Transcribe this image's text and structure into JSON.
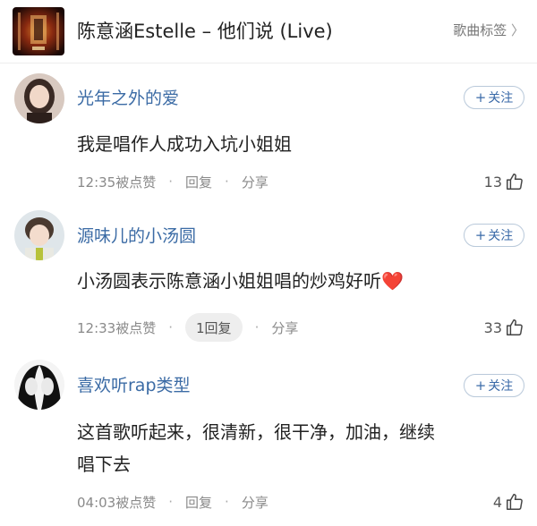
{
  "header": {
    "song_title": "陈意涵Estelle – 他们说 (Live)",
    "song_tags_label": "歌曲标签",
    "chevron_glyph": "〉"
  },
  "follow_label": "关注",
  "follow_plus": "+",
  "comments": [
    {
      "username": "光年之外的爱",
      "text": "我是唱作人成功入坑小姐姐",
      "time": "12:35被点赞",
      "reply_label": "回复",
      "share_label": "分享",
      "likes": "13"
    },
    {
      "username": "源味儿的小汤圆",
      "text": "小汤圆表示陈意涵小姐姐唱的炒鸡好听",
      "emoji": "❤️",
      "time": "12:33被点赞",
      "reply_label": "1回复",
      "share_label": "分享",
      "likes": "33"
    },
    {
      "username": "喜欢听rap类型",
      "text_line1": "这首歌听起来，很清新，很干净，加油，继续",
      "text_line2": "唱下去",
      "time": "04:03被点赞",
      "reply_label": "回复",
      "share_label": "分享",
      "likes": "4"
    }
  ],
  "colors": {
    "username": "#3b6ba5",
    "follow_border": "#b9c9da",
    "meta": "#8a8a8a",
    "heart": "#e53b3b"
  },
  "icons": [
    "album-cover-icon",
    "chevron-right-icon",
    "thumbs-up-icon",
    "heart-icon"
  ]
}
